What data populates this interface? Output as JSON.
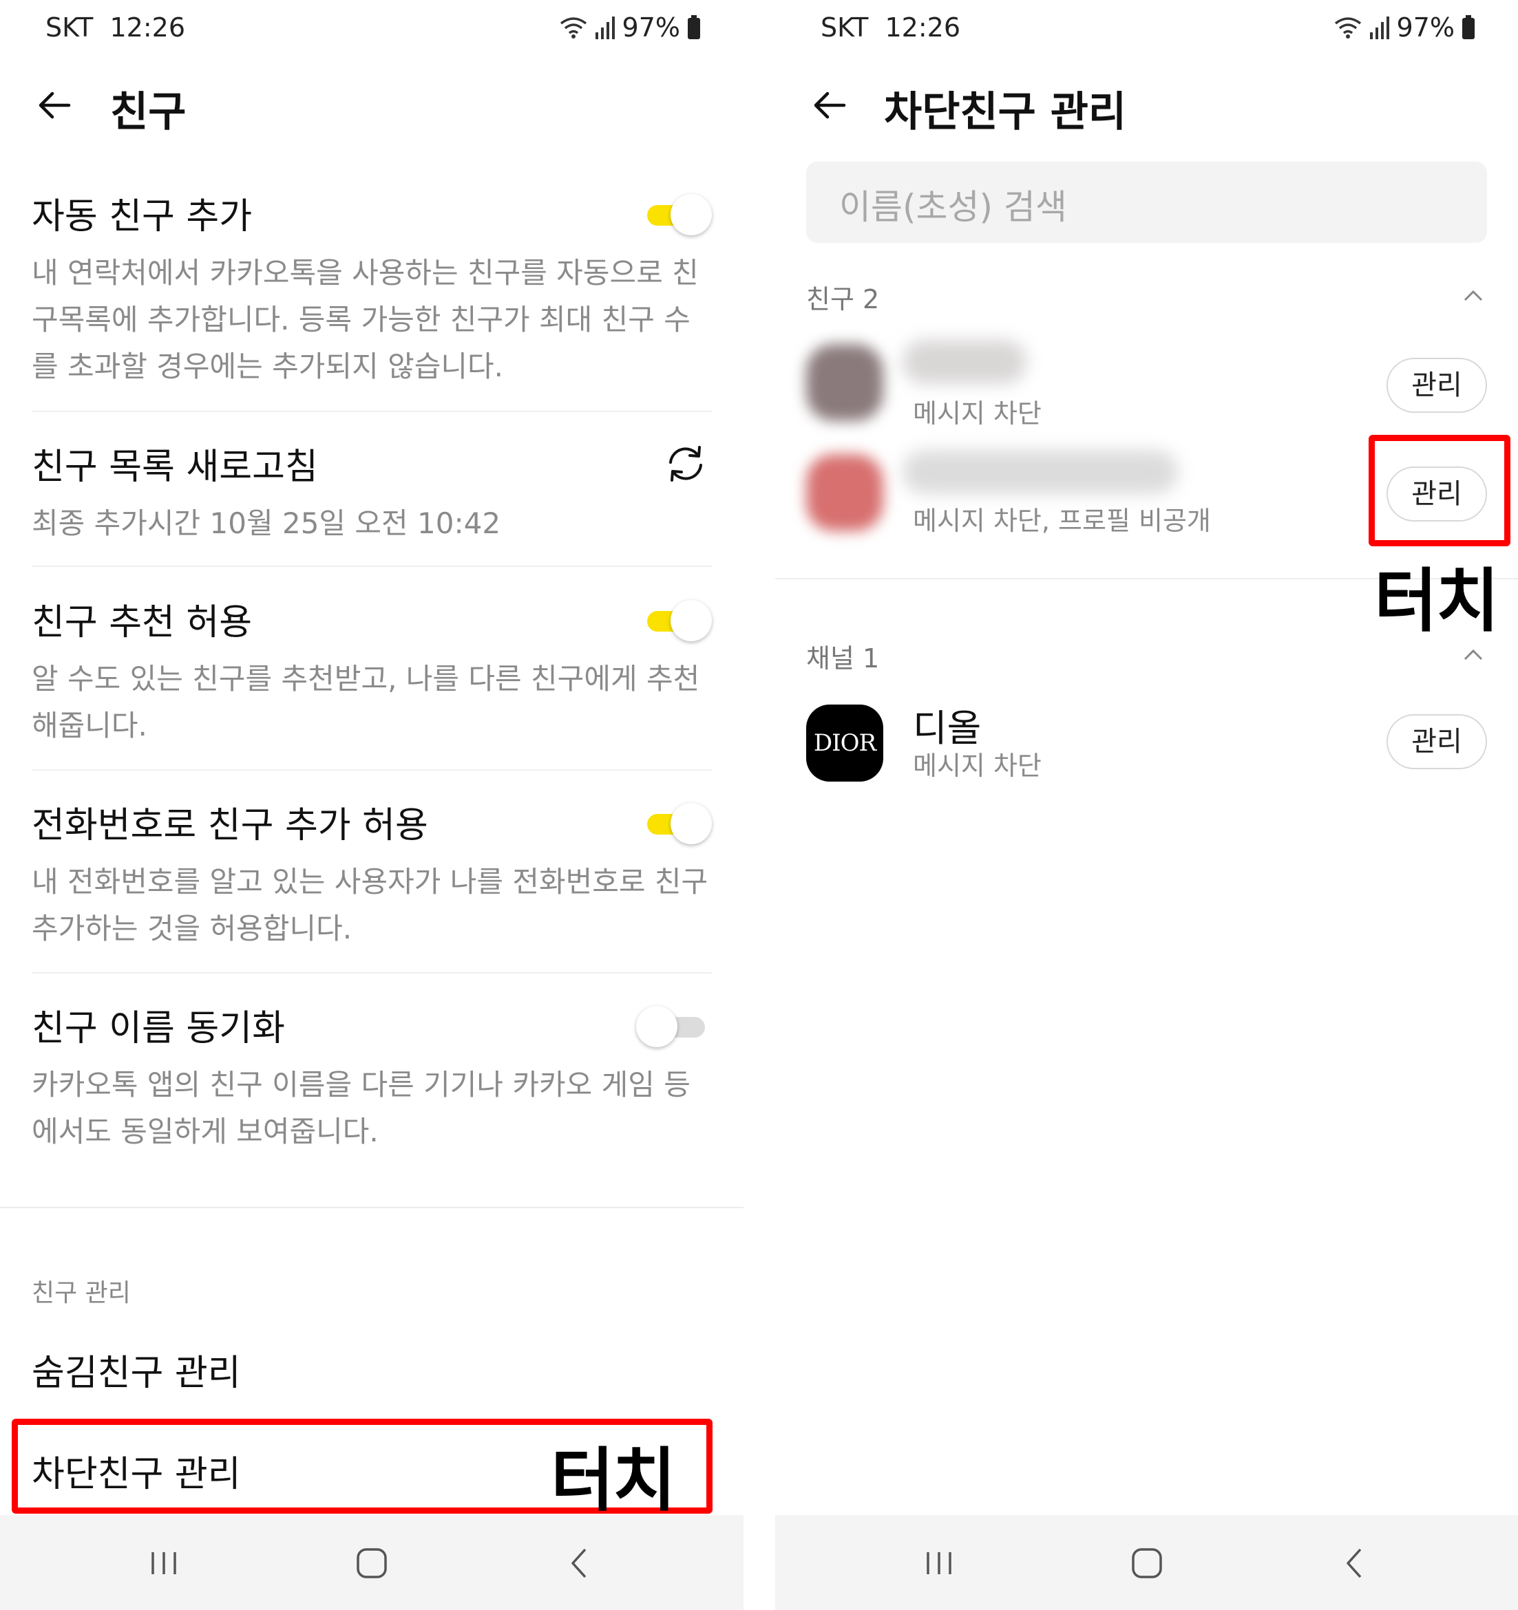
{
  "status_bar": {
    "carrier": "SKT",
    "time": "12:26",
    "battery": "97%"
  },
  "left": {
    "title": "친구",
    "settings": [
      {
        "title": "자동 친구 추가",
        "desc": "내 연락처에서 카카오톡을 사용하는 친구를 자동으로 친구목록에 추가합니다. 등록 가능한 친구가 최대 친구 수를 초과할 경우에는 추가되지 않습니다.",
        "toggle": "on"
      },
      {
        "title": "친구 목록 새로고침",
        "desc": "최종 추가시간 10월 25일 오전 10:42",
        "icon": "refresh-icon"
      },
      {
        "title": "친구 추천 허용",
        "desc": "알 수도 있는 친구를 추천받고, 나를 다른 친구에게 추천해줍니다.",
        "toggle": "on"
      },
      {
        "title": "전화번호로 친구 추가 허용",
        "desc": "내 전화번호를 알고 있는 사용자가 나를 전화번호로 친구 추가하는 것을 허용합니다.",
        "toggle": "on"
      },
      {
        "title": "친구 이름 동기화",
        "desc": "카카오톡 앱의 친구 이름을 다른 기기나 카카오 게임 등에서도 동일하게 보여줍니다.",
        "toggle": "off"
      }
    ],
    "section_label": "친구 관리",
    "menu": [
      "숨김친구 관리",
      "차단친구 관리"
    ],
    "touch_label": "터치"
  },
  "right": {
    "title": "차단친구 관리",
    "search_placeholder": "이름(초성) 검색",
    "friends_label": "친구 2",
    "friends": [
      {
        "sub": "메시지 차단",
        "button": "관리"
      },
      {
        "sub": "메시지 차단, 프로필 비공개",
        "button": "관리"
      }
    ],
    "channels_label": "채널 1",
    "channels": [
      {
        "name": "디올",
        "logo": "DIOR",
        "sub": "메시지 차단",
        "button": "관리"
      }
    ],
    "touch_label": "터치"
  },
  "colors": {
    "toggle_on": "#fae100",
    "highlight": "#ff0000"
  },
  "icons": [
    "back-arrow-icon",
    "wifi-icon",
    "signal-icon",
    "battery-icon",
    "refresh-icon",
    "chevron-up-icon",
    "recent-apps-icon",
    "home-icon",
    "nav-back-icon"
  ]
}
